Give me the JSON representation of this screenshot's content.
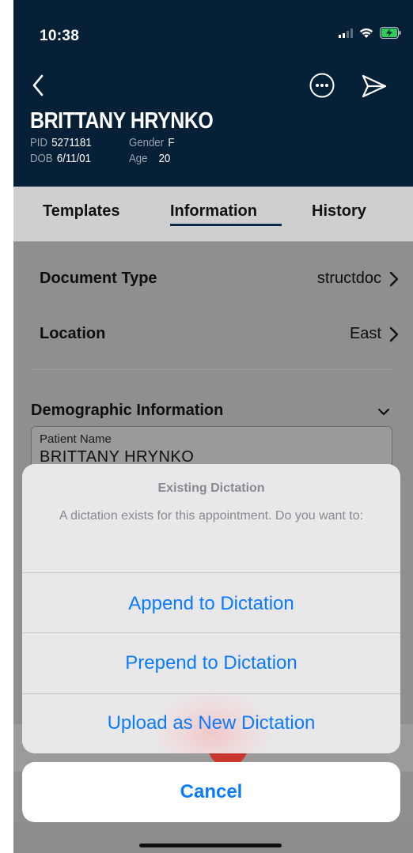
{
  "status_bar": {
    "time": "10:38"
  },
  "patient": {
    "name": "BRITTANY HRYNKO",
    "pid_label": "PID",
    "pid_value": "5271181",
    "gender_label": "Gender",
    "gender_value": "F",
    "dob_label": "DOB",
    "dob_value": "6/11/01",
    "age_label": "Age",
    "age_value": "20"
  },
  "tabs": [
    {
      "label": "Templates"
    },
    {
      "label": "Information",
      "selected": true
    },
    {
      "label": "History"
    }
  ],
  "info": {
    "document_type_label": "Document Type",
    "document_type_value": "structdoc",
    "location_label": "Location",
    "location_value": "East",
    "demographic_title": "Demographic Information",
    "patient_name_label": "Patient Name",
    "patient_name_value": "BRITTANY HRYNKO"
  },
  "action_sheet": {
    "title": "Existing Dictation",
    "message": "A dictation exists for this appointment. Do you want to:",
    "append_label": "Append to Dictation",
    "prepend_label": "Prepend to Dictation",
    "upload_label": "Upload as New Dictation",
    "cancel_label": "Cancel"
  },
  "colors": {
    "header_bg": "#062037",
    "action_blue": "#0a7aff",
    "tab_underline": "#0d2b4a"
  }
}
